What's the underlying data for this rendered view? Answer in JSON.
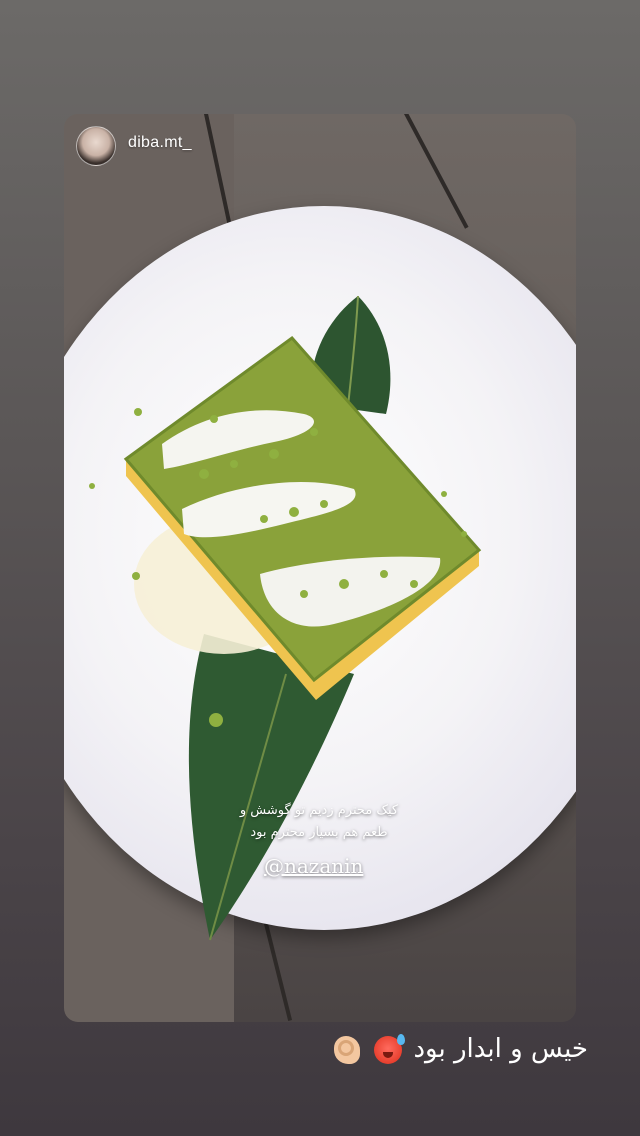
{
  "story": {
    "username": "diba.mt_",
    "caption_line1": "کیک محترم زدیم تو گوشش و",
    "caption_line2": "طعم هم بسیار محترم بود",
    "mention": "@nazanin"
  },
  "footer": {
    "text": "خیس و ابدار بود",
    "emoji_1": "hot-face-emoji",
    "emoji_2": "pinching-hand-emoji"
  },
  "colors": {
    "plate": "#f2f1f5",
    "leaf": "#2f5a32",
    "cake_top": "#8aa23a",
    "cake_sponge": "#f1cf5a",
    "cream": "#f6f6f3"
  }
}
